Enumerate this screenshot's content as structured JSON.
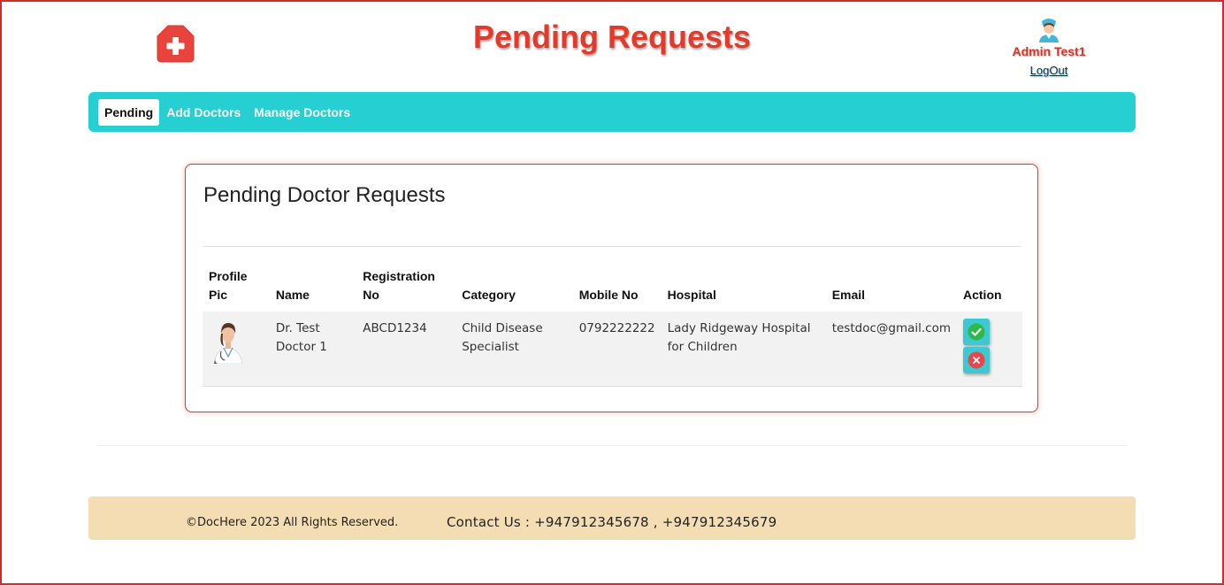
{
  "header": {
    "title": "Pending Requests",
    "logo_icon": "medical-cross-icon",
    "user_name": "Admin Test1",
    "logout_label": "LogOut"
  },
  "nav": {
    "items": [
      {
        "label": "Pending",
        "active": true
      },
      {
        "label": "Add Doctors",
        "active": false
      },
      {
        "label": "Manage Doctors",
        "active": false
      }
    ]
  },
  "card": {
    "title": "Pending Doctor Requests",
    "columns": {
      "profile_pic": "Profile Pic",
      "name": "Name",
      "registration_no": "Registration No",
      "category": "Category",
      "mobile_no": "Mobile No",
      "hospital": "Hospital",
      "email": "Email",
      "action": "Action"
    },
    "rows": [
      {
        "name": "Dr. Test Doctor 1",
        "registration_no": "ABCD1234",
        "category": "Child Disease Specialist",
        "mobile_no": "0792222222",
        "hospital": "Lady Ridgeway Hospital for Children",
        "email": "testdoc@gmail.com",
        "approve_icon": "check-circle-icon",
        "reject_icon": "close-circle-icon"
      }
    ]
  },
  "footer": {
    "copyright": "©DocHere 2023 All Rights Reserved.",
    "contact": "Contact Us : +947912345678 , +947912345679"
  },
  "colors": {
    "accent_red": "#e5392a",
    "nav_teal": "#26cfd2",
    "footer_bg": "#f5ddb3",
    "approve_green": "#2fb84a",
    "reject_red": "#e8474a"
  }
}
